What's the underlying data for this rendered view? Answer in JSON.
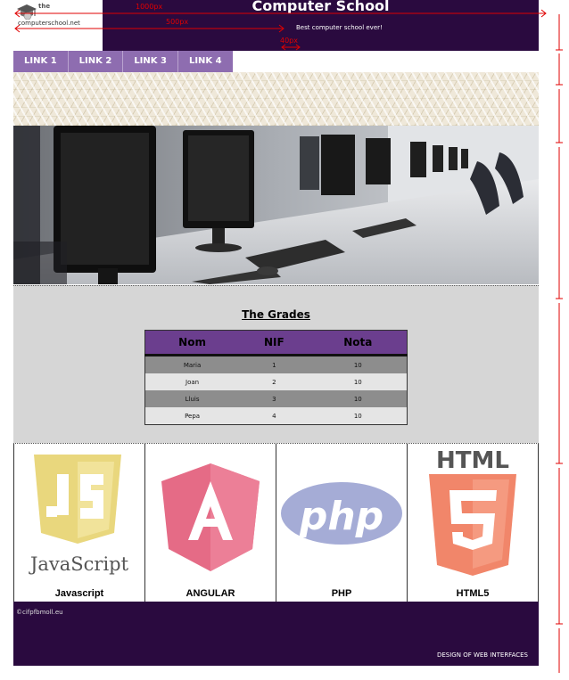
{
  "header": {
    "logo_top": "the",
    "logo_bottom": "computerschool.net",
    "title": "Computer School",
    "tagline": "Best computer school ever!"
  },
  "nav": {
    "links": [
      {
        "label": "LINK 1"
      },
      {
        "label": "LINK 2"
      },
      {
        "label": "LINK 3"
      },
      {
        "label": "LINK 4"
      }
    ]
  },
  "grades": {
    "title": "The Grades",
    "columns": [
      "Nom",
      "NIF",
      "Nota"
    ],
    "rows": [
      {
        "nom": "Maria",
        "nif": "1",
        "nota": "10"
      },
      {
        "nom": "Joan",
        "nif": "2",
        "nota": "10"
      },
      {
        "nom": "Lluis",
        "nif": "3",
        "nota": "10"
      },
      {
        "nom": "Pepa",
        "nif": "4",
        "nota": "10"
      }
    ]
  },
  "techs": [
    {
      "label": "Javascript",
      "logo_text": "JavaScript",
      "icon": "javascript-logo",
      "color": "#e9d77d"
    },
    {
      "label": "ANGULAR",
      "logo_text": "A",
      "icon": "angular-logo",
      "color": "#e56b86"
    },
    {
      "label": "PHP",
      "logo_text": "php",
      "icon": "php-logo",
      "color": "#a5acd6"
    },
    {
      "label": "HTML5",
      "logo_text": "HTML",
      "icon": "html5-logo",
      "color": "#f1866a"
    }
  ],
  "footer": {
    "copyright": "©cifpfbmoll.eu",
    "design": "DESIGN OF WEB INTERFACES"
  },
  "annotations": {
    "w1000": "1000px",
    "w500": "500px",
    "w40": "40px"
  },
  "colors": {
    "brand_dark": "#2a0a3f",
    "nav_purple": "#8e6db0",
    "table_header": "#6b3e8e",
    "annotation_red": "#e00000"
  }
}
